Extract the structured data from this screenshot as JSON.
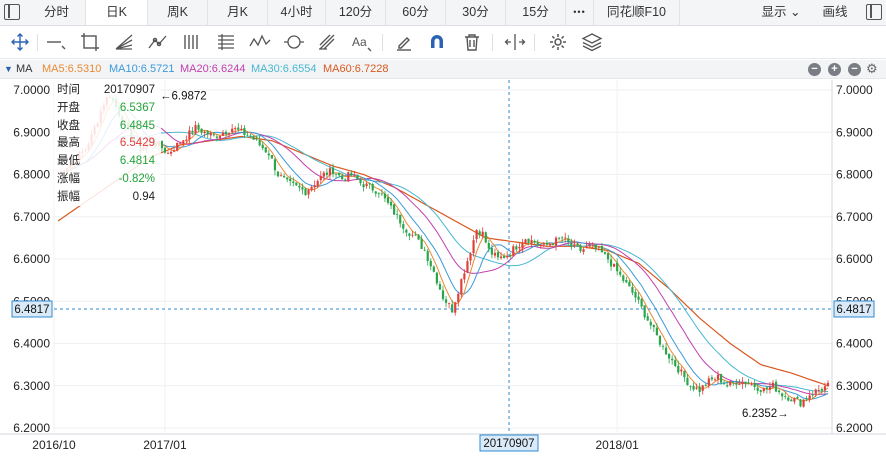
{
  "tabs": [
    "分时",
    "日K",
    "周K",
    "月K",
    "4小时",
    "120分",
    "60分",
    "30分",
    "15分",
    "同花顺F10"
  ],
  "active_tab": "日K",
  "more_glyph": "•••",
  "right_menu": {
    "display_label": "显示",
    "display_arrow": "⌄",
    "draw_label": "画线"
  },
  "ma_bar": {
    "label": "MA",
    "items": [
      {
        "text": "MA5:6.5310",
        "color": "#e98a35"
      },
      {
        "text": "MA10:6.5721",
        "color": "#3a9ad9"
      },
      {
        "text": "MA20:6.6244",
        "color": "#c23fb0"
      },
      {
        "text": "MA30:6.6554",
        "color": "#48b7d0"
      },
      {
        "text": "MA60:6.7228",
        "color": "#d9581f"
      }
    ],
    "buttons": [
      "−",
      "+",
      "−",
      "gear-icon"
    ]
  },
  "info_box": {
    "rows": [
      {
        "k": "时间",
        "v": "20170907",
        "color": "#222222"
      },
      {
        "k": "开盘",
        "v": "6.5367",
        "color": "#22a33a"
      },
      {
        "k": "收盘",
        "v": "6.4845",
        "color": "#22a33a"
      },
      {
        "k": "最高",
        "v": "6.5429",
        "color": "#e23b3b"
      },
      {
        "k": "最低",
        "v": "6.4814",
        "color": "#22a33a"
      },
      {
        "k": "涨幅",
        "v": "-0.82%",
        "color": "#22a33a"
      },
      {
        "k": "振幅",
        "v": "0.94",
        "color": "#222222"
      }
    ]
  },
  "annotations": {
    "high": "←6.9872",
    "low": "6.2352→"
  },
  "crosshair": {
    "price": "6.4817",
    "date": "20170907"
  },
  "chart_data": {
    "type": "candlestick",
    "y_ticks": [
      "7.0000",
      "6.9000",
      "6.8000",
      "6.7000",
      "6.6000",
      "6.5000",
      "6.4000",
      "6.3000",
      "6.2000"
    ],
    "ylim": [
      6.2,
      7.0
    ],
    "x_ticks": [
      "2016/10",
      "2017/01",
      "2018/01"
    ],
    "price_path": [
      [
        0,
        6.8
      ],
      [
        3,
        6.82
      ],
      [
        6,
        6.84
      ],
      [
        9,
        6.86
      ],
      [
        11,
        6.89
      ],
      [
        13,
        6.93
      ],
      [
        15,
        6.97
      ],
      [
        17,
        6.99
      ],
      [
        19,
        6.96
      ],
      [
        21,
        6.93
      ],
      [
        24,
        6.89
      ],
      [
        27,
        6.86
      ],
      [
        30,
        6.88
      ],
      [
        33,
        6.87
      ],
      [
        36,
        6.85
      ],
      [
        39,
        6.87
      ],
      [
        42,
        6.89
      ],
      [
        45,
        6.91
      ],
      [
        48,
        6.9
      ],
      [
        51,
        6.89
      ],
      [
        54,
        6.9
      ],
      [
        57,
        6.91
      ],
      [
        60,
        6.9
      ],
      [
        63,
        6.89
      ],
      [
        66,
        6.87
      ],
      [
        69,
        6.85
      ],
      [
        72,
        6.8
      ],
      [
        75,
        6.78
      ],
      [
        78,
        6.77
      ],
      [
        81,
        6.76
      ],
      [
        84,
        6.78
      ],
      [
        87,
        6.8
      ],
      [
        90,
        6.81
      ],
      [
        93,
        6.79
      ],
      [
        96,
        6.8
      ],
      [
        99,
        6.78
      ],
      [
        102,
        6.77
      ],
      [
        105,
        6.76
      ],
      [
        108,
        6.73
      ],
      [
        111,
        6.7
      ],
      [
        114,
        6.67
      ],
      [
        117,
        6.65
      ],
      [
        120,
        6.62
      ],
      [
        123,
        6.57
      ],
      [
        126,
        6.51
      ],
      [
        129,
        6.48
      ],
      [
        132,
        6.55
      ],
      [
        135,
        6.62
      ],
      [
        137,
        6.67
      ],
      [
        139,
        6.66
      ],
      [
        141,
        6.62
      ],
      [
        144,
        6.6
      ],
      [
        147,
        6.61
      ],
      [
        150,
        6.63
      ],
      [
        153,
        6.65
      ],
      [
        156,
        6.64
      ],
      [
        159,
        6.63
      ],
      [
        162,
        6.64
      ],
      [
        165,
        6.65
      ],
      [
        168,
        6.63
      ],
      [
        171,
        6.62
      ],
      [
        174,
        6.63
      ],
      [
        177,
        6.62
      ],
      [
        180,
        6.6
      ],
      [
        183,
        6.57
      ],
      [
        186,
        6.54
      ],
      [
        189,
        6.51
      ],
      [
        192,
        6.47
      ],
      [
        195,
        6.43
      ],
      [
        198,
        6.39
      ],
      [
        201,
        6.36
      ],
      [
        204,
        6.33
      ],
      [
        207,
        6.3
      ],
      [
        210,
        6.29
      ],
      [
        213,
        6.31
      ],
      [
        216,
        6.32
      ],
      [
        219,
        6.3
      ],
      [
        222,
        6.31
      ],
      [
        225,
        6.31
      ],
      [
        228,
        6.3
      ],
      [
        231,
        6.29
      ],
      [
        234,
        6.3
      ],
      [
        237,
        6.28
      ],
      [
        240,
        6.27
      ],
      [
        243,
        6.26
      ],
      [
        246,
        6.28
      ],
      [
        249,
        6.29
      ],
      [
        252,
        6.3
      ]
    ],
    "ma60_path": [
      [
        0,
        6.69
      ],
      [
        10,
        6.74
      ],
      [
        20,
        6.79
      ],
      [
        30,
        6.84
      ],
      [
        40,
        6.87
      ],
      [
        50,
        6.88
      ],
      [
        60,
        6.89
      ],
      [
        70,
        6.88
      ],
      [
        80,
        6.85
      ],
      [
        90,
        6.82
      ],
      [
        100,
        6.8
      ],
      [
        110,
        6.77
      ],
      [
        120,
        6.73
      ],
      [
        130,
        6.69
      ],
      [
        140,
        6.65
      ],
      [
        150,
        6.64
      ],
      [
        160,
        6.63
      ],
      [
        170,
        6.63
      ],
      [
        180,
        6.62
      ],
      [
        190,
        6.59
      ],
      [
        200,
        6.53
      ],
      [
        210,
        6.46
      ],
      [
        220,
        6.4
      ],
      [
        230,
        6.35
      ],
      [
        240,
        6.33
      ],
      [
        252,
        6.3
      ]
    ]
  }
}
